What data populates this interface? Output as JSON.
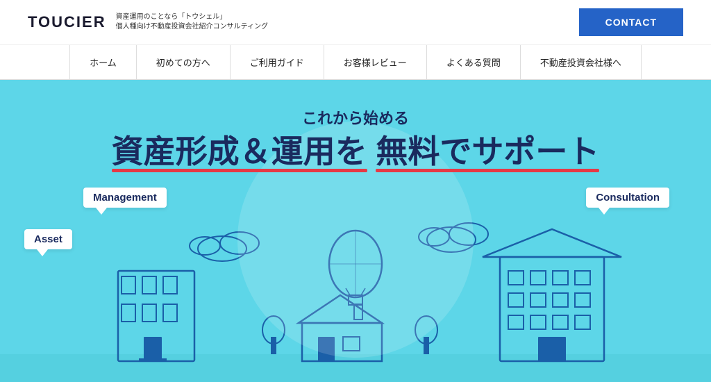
{
  "header": {
    "logo": "TOUCIER",
    "tagline_main": "資産運用のことなら「トウシェル」",
    "tagline_sub": "個人種向け不動産投資会社紹介コンサルティング",
    "contact_label": "CONTACT"
  },
  "nav": {
    "items": [
      {
        "label": "ホーム"
      },
      {
        "label": "初めての方へ"
      },
      {
        "label": "ご利用ガイド"
      },
      {
        "label": "お客様レビュー"
      },
      {
        "label": "よくある質問"
      },
      {
        "label": "不動産投資会社様へ"
      }
    ]
  },
  "hero": {
    "subtitle": "これから始める",
    "title_part1": "資産形成＆運用を",
    "title_part2": "無料でサポート",
    "bubble_management": "Management",
    "bubble_consultation": "Consultation",
    "bubble_asset": "Asset"
  }
}
